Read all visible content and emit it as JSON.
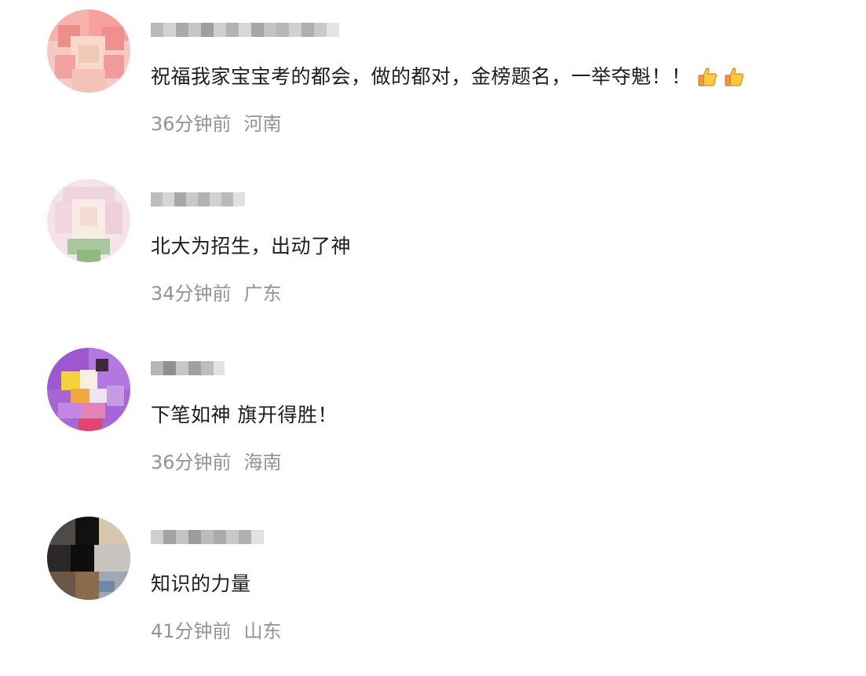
{
  "comments": [
    {
      "text": "祝福我家宝宝考的都会，做的都对，金榜题名，一举夺魁！！",
      "emoji": [
        "thumbs-up-icon",
        "thumbs-up-icon"
      ],
      "time": "36分钟前",
      "location": "河南"
    },
    {
      "text": "北大为招生，出动了神",
      "time": "34分钟前",
      "location": "广东"
    },
    {
      "text": "下笔如神 旗开得胜！",
      "time": "36分钟前",
      "location": "海南"
    },
    {
      "text": "知识的力量",
      "time": "41分钟前",
      "location": "山东"
    }
  ],
  "colors": {
    "text": "#1d1d1d",
    "meta": "#8f939c",
    "background": "#ffffff"
  }
}
